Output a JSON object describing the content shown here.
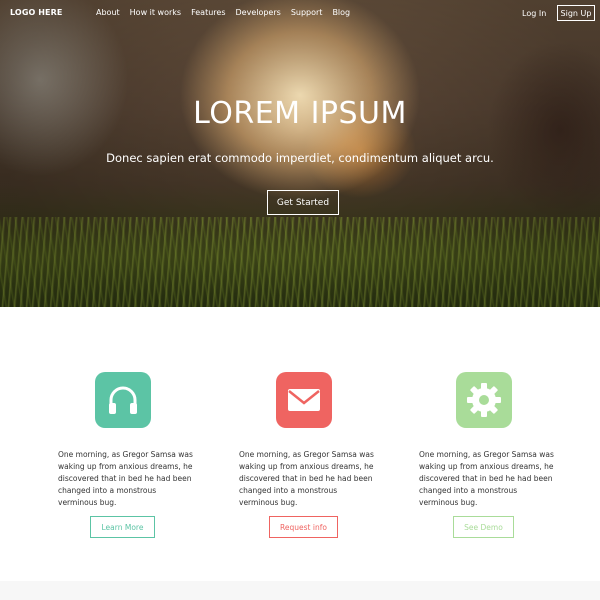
{
  "nav": {
    "logo": "LOGO HERE",
    "links": [
      "About",
      "How it works",
      "Features",
      "Developers",
      "Support",
      "Blog"
    ],
    "login": "Log In",
    "signup": "Sign Up"
  },
  "hero": {
    "title": "LOREM IPSUM",
    "subtitle": "Donec sapien erat commodo imperdiet, condimentum aliquet arcu.",
    "cta": "Get Started"
  },
  "features": [
    {
      "icon": "headphones-icon",
      "color": "#5cc4a5",
      "text": "One morning, as Gregor Samsa was waking up from anxious dreams, he discovered that in bed he had been changed into a monstrous verminous bug.",
      "button": "Learn More"
    },
    {
      "icon": "envelope-icon",
      "color": "#ef6461",
      "text": "One morning, as Gregor Samsa was waking up from anxious dreams, he discovered that in bed he had been changed into a monstrous verminous bug.",
      "button": "Request info"
    },
    {
      "icon": "gear-icon",
      "color": "#a9dc99",
      "text": "One morning, as Gregor Samsa was waking up from anxious dreams, he discovered that in bed he had been changed into a monstrous verminous bug.",
      "button": "See Demo"
    }
  ]
}
